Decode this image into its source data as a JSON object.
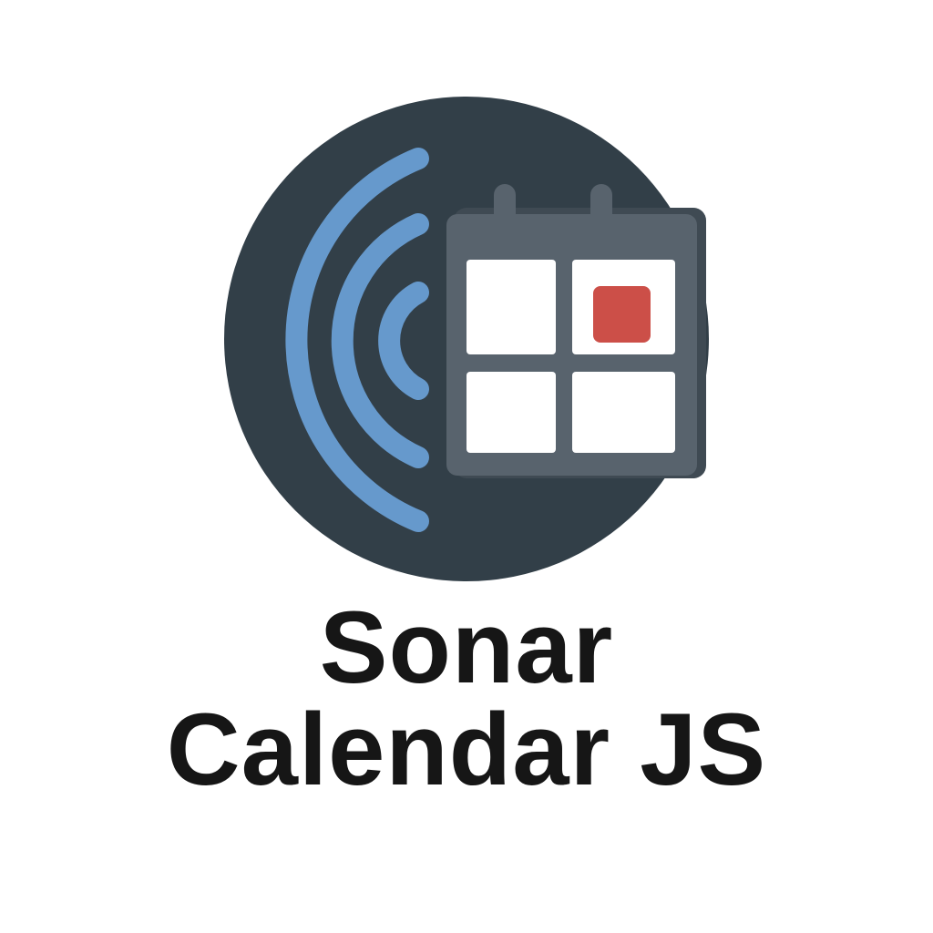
{
  "logo": {
    "title_line_1": "Sonar",
    "title_line_2": "Calendar JS",
    "colors": {
      "background": "#ffffff",
      "circle": "#323f48",
      "sonar_waves": "#6699cc",
      "calendar_frame": "#58636d",
      "calendar_cell": "#ffffff",
      "event_marker": "#cc4f48",
      "text": "#161616"
    },
    "icons": [
      "sonar-waves-icon",
      "calendar-icon"
    ]
  }
}
